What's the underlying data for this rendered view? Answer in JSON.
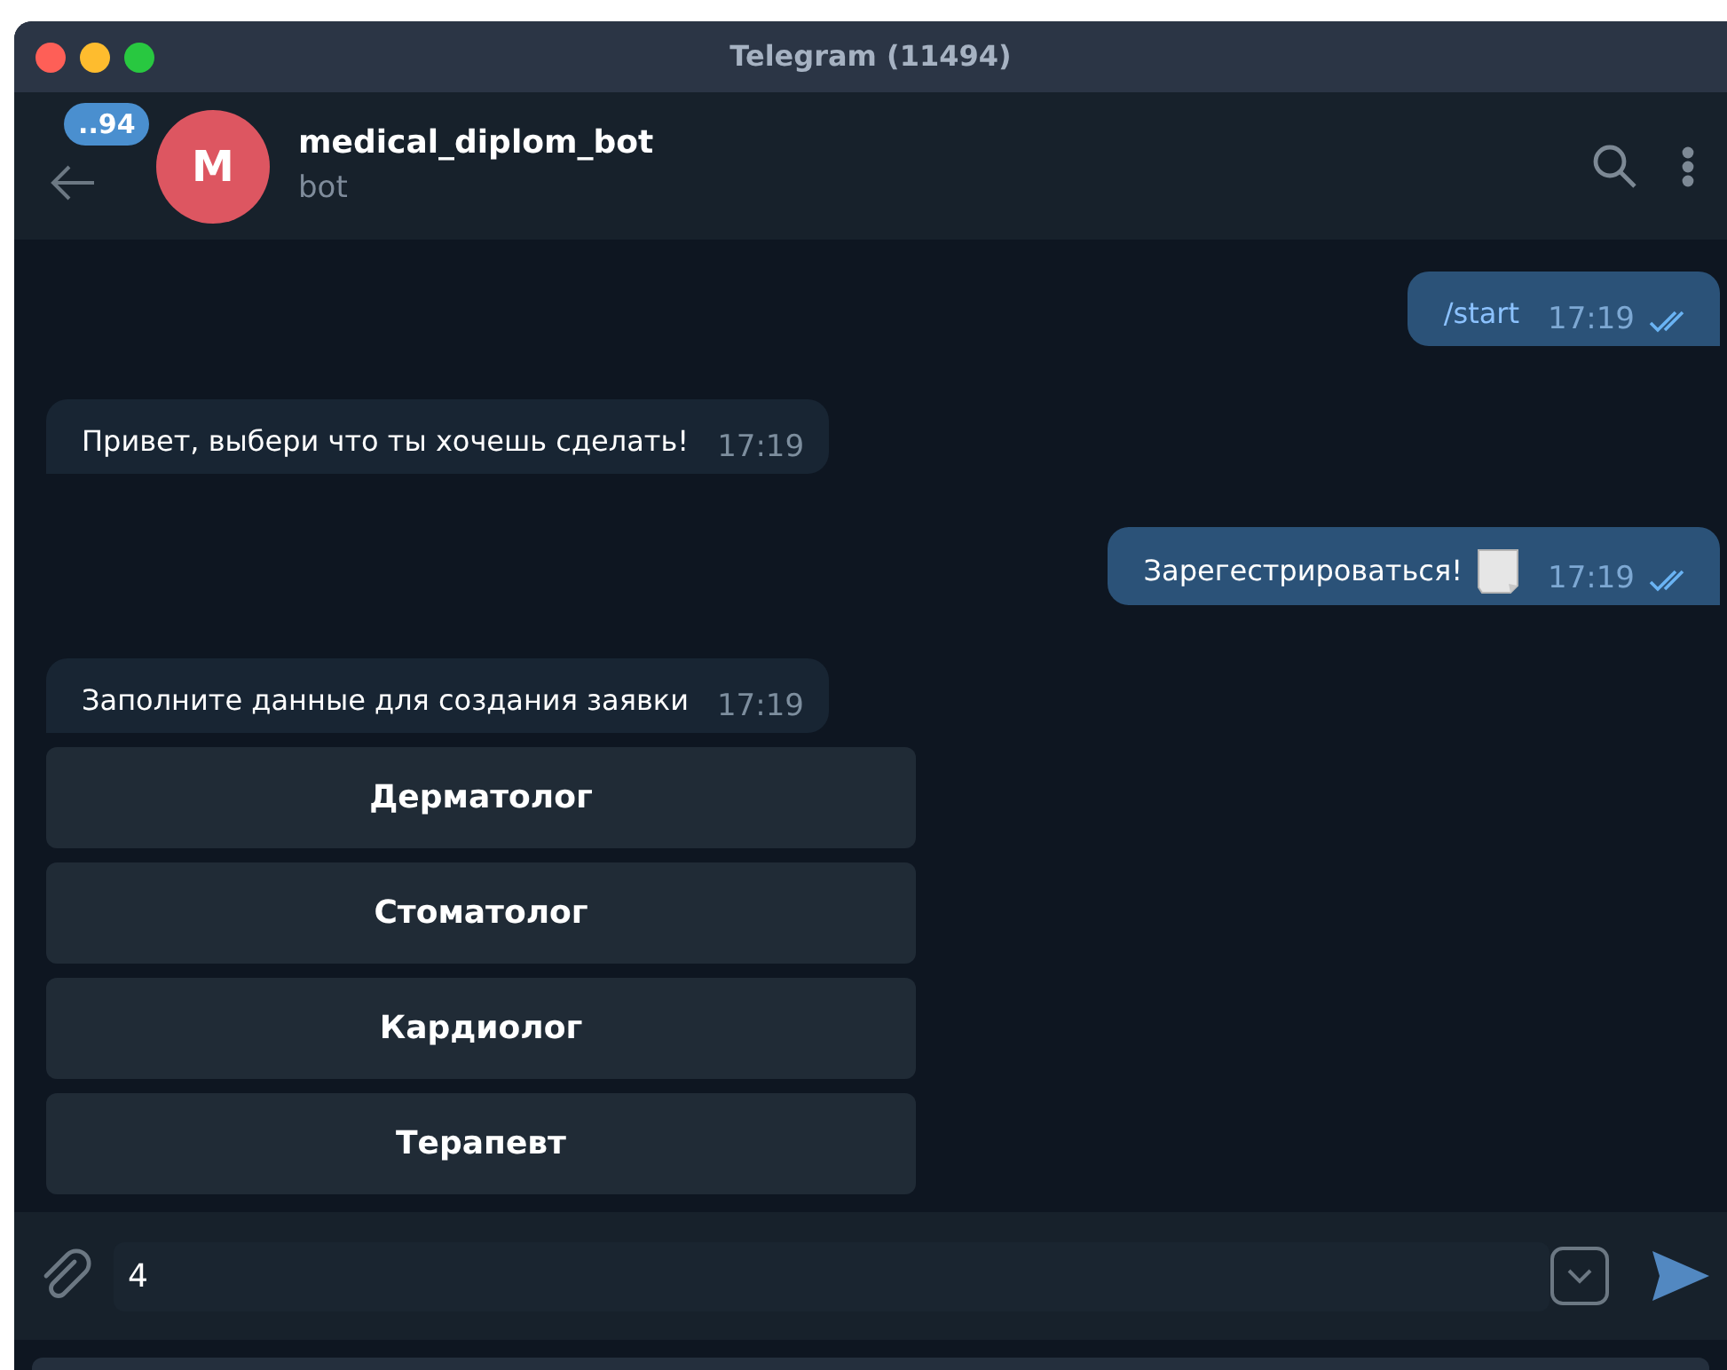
{
  "window": {
    "title": "Telegram (11494)"
  },
  "header": {
    "unread_badge": "..94",
    "avatar_letter": "M",
    "name": "medical_diplom_bot",
    "status": "bot"
  },
  "messages": [
    {
      "kind": "out",
      "text": "/start",
      "time": "17:19",
      "read": true,
      "command": true
    },
    {
      "kind": "in",
      "text": "Привет, выбери что ты хочешь сделать!",
      "time": "17:19"
    },
    {
      "kind": "out",
      "text": "Зарегестрироваться!",
      "time": "17:19",
      "read": true,
      "command": false,
      "sticker_icon": true
    },
    {
      "kind": "in",
      "text": "Заполните данные для создания заявки",
      "time": "17:19"
    }
  ],
  "keyboard": [
    "Дерматолог",
    "Стоматолог",
    "Кардиолог",
    "Терапевт"
  ],
  "composer": {
    "value": "4"
  }
}
